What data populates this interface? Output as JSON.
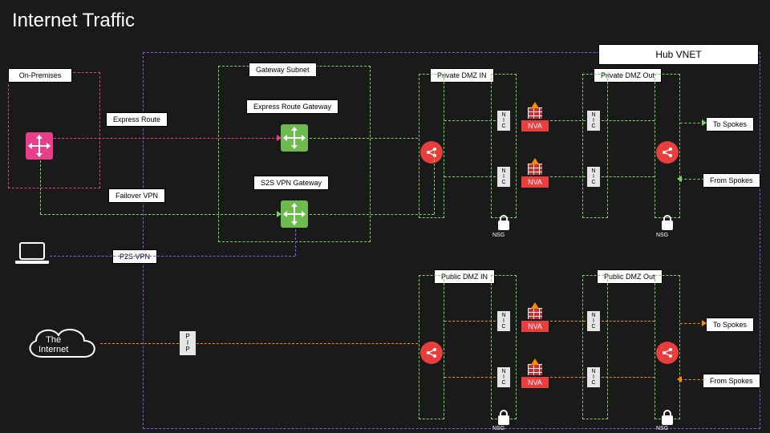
{
  "title": "Internet Traffic",
  "hub_vnet": "Hub VNET",
  "on_premises": "On-Premises",
  "gateway_subnet": "Gateway Subnet",
  "express_route_gateway": "Express Route Gateway",
  "express_route": "Express Route",
  "s2s_vpn_gateway": "S2S VPN Gateway",
  "failover_vpn": "Failover VPN",
  "p2s_vpn": "P2S VPN",
  "the_internet": "The\nInternet",
  "pip": "P\nI\nP",
  "dmz": {
    "private_in": "Private DMZ IN",
    "private_out": "Private DMZ Out",
    "public_in": "Public DMZ IN",
    "public_out": "Public DMZ Out"
  },
  "nic": "N\nI\nC",
  "nva": "NVA",
  "nsg": "NSG",
  "to_spokes": "To Spokes",
  "from_spokes": "From Spokes",
  "colors": {
    "green": "#7bd561",
    "pink": "#e83e8c",
    "purple": "#8a4fff",
    "orange": "#ff8a00",
    "red": "#e83e3e"
  }
}
